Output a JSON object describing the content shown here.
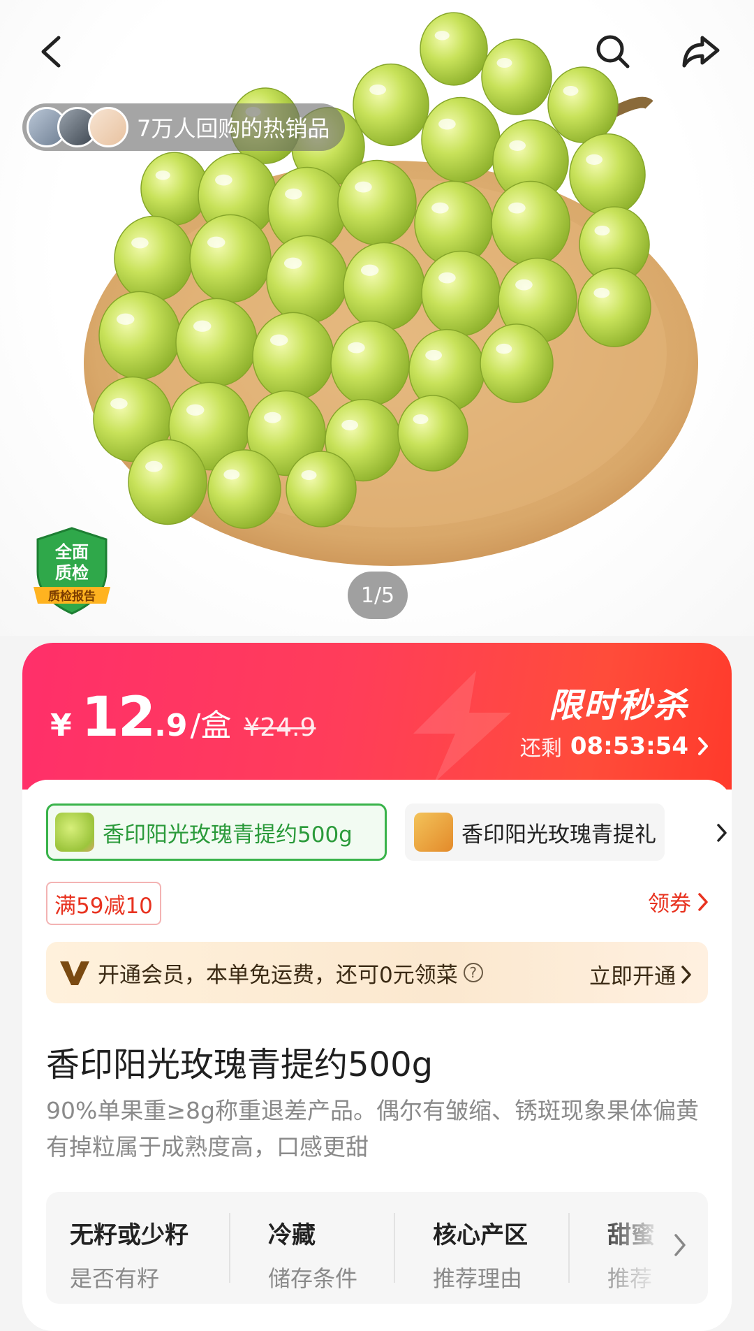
{
  "hero": {
    "buyers_text": "7万人回购的热销品",
    "pager": "1/5",
    "badge": {
      "line1": "全面",
      "line2": "质检",
      "line3": "质检报告"
    }
  },
  "price": {
    "currency": "¥",
    "integer": "12",
    "decimal": ".9",
    "unit": "/盒",
    "original": "¥24.9",
    "flash_title": "限时秒杀",
    "countdown_label": "还剩",
    "countdown_time": "08:53:54"
  },
  "skus": [
    {
      "label": "香印阳光玫瑰青提约500g",
      "selected": true
    },
    {
      "label": "香印阳光玫瑰青提礼",
      "selected": false
    }
  ],
  "coupon": {
    "tag": "满59减10",
    "get": "领券"
  },
  "member": {
    "text": "开通会员，本单免运费，还可0元领菜",
    "help": "?",
    "action": "立即开通"
  },
  "product": {
    "title": "香印阳光玫瑰青提约500g",
    "description": "90%单果重≥8g称重退差产品。偶尔有皱缩、锈斑现象果体偏黄有掉粒属于成熟度高，口感更甜"
  },
  "attributes": [
    {
      "value": "无籽或少籽",
      "key": "是否有籽"
    },
    {
      "value": "冷藏",
      "key": "储存条件"
    },
    {
      "value": "核心产区",
      "key": "推荐理由"
    },
    {
      "value": "甜蜜",
      "key": "推荐"
    }
  ],
  "colors": {
    "accent": "#ff3d5a",
    "green": "#39b34a",
    "coupon": "#e8321f"
  }
}
